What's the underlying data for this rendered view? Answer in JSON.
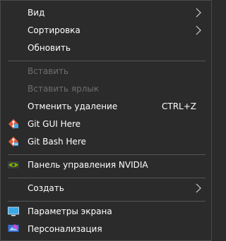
{
  "context_menu": {
    "items": [
      {
        "label": "Вид",
        "has_submenu": true
      },
      {
        "label": "Сортировка",
        "has_submenu": true
      },
      {
        "label": "Обновить"
      },
      {
        "label": "Вставить",
        "disabled": true
      },
      {
        "label": "Вставить ярлык",
        "disabled": true
      },
      {
        "label": "Отменить удаление",
        "shortcut": "CTRL+Z"
      },
      {
        "label": "Git GUI Here",
        "icon": "git-gui-icon"
      },
      {
        "label": "Git Bash Here",
        "icon": "git-bash-icon"
      },
      {
        "label": "Панель управления NVIDIA",
        "icon": "nvidia-icon"
      },
      {
        "label": "Создать",
        "has_submenu": true
      },
      {
        "label": "Параметры экрана",
        "icon": "display-settings-icon"
      },
      {
        "label": "Персонализация",
        "icon": "personalization-icon"
      }
    ]
  },
  "colors": {
    "background": "#2b2b2b",
    "text": "#ffffff",
    "disabled_text": "#6e6e6e",
    "separator": "#555555",
    "git_red": "#e05a3a",
    "git_blue": "#4aa3df",
    "nvidia_green": "#76b900",
    "display_blue": "#3ba8e8"
  }
}
